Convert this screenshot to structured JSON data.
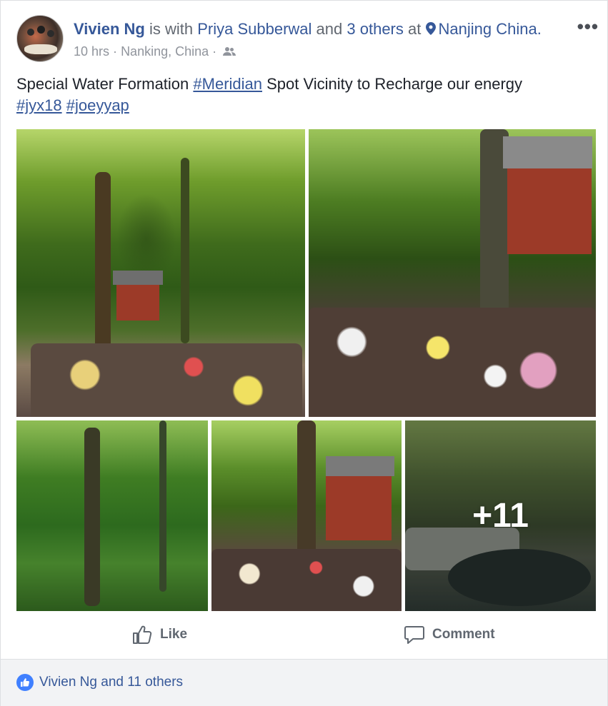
{
  "post": {
    "author": "Vivien Ng",
    "with_text": "is with",
    "tagged_person": "Priya Subberwal",
    "and_text": "and",
    "others": "3 others",
    "at_text": "at",
    "location": "Nanjing China.",
    "time": "10 hrs",
    "separator": "·",
    "place": "Nanking, China",
    "separator2": "·",
    "audience_icon": "friends-icon",
    "more_label": "•••",
    "text_before": "Special Water Formation ",
    "hashtag_meridian": "#Meridian",
    "text_after": " Spot Vicinity to Recharge our energy",
    "hashtag_jyx18": "#jyx18",
    "hashtag_joeyyap": "#joeyyap"
  },
  "photos": {
    "more_count": "+11"
  },
  "actions": {
    "like_label": "Like",
    "comment_label": "Comment"
  },
  "reactions": {
    "summary": "Vivien Ng and 11 others"
  },
  "colors": {
    "link": "#365899",
    "meta": "#90949c",
    "like_badge": "#4080ff",
    "footer_bg": "#f2f3f5"
  }
}
